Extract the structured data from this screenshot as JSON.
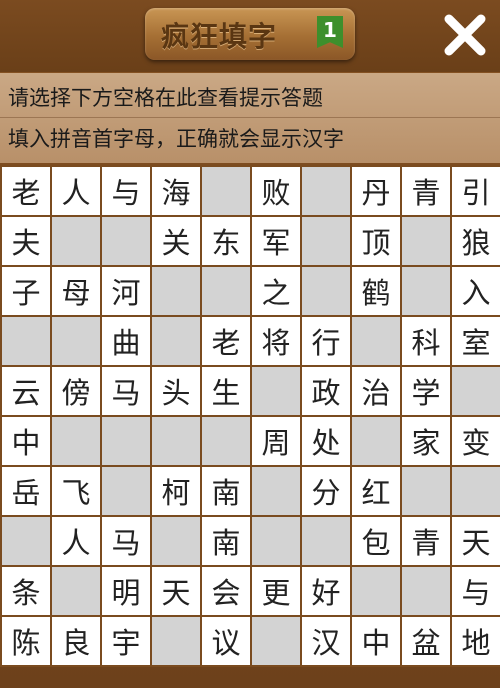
{
  "header": {
    "title": "疯狂填字",
    "level": "1"
  },
  "hints": {
    "line1": "请选择下方空格在此查看提示答题",
    "line2": "填入拼音首字母，正确就会显示汉字"
  },
  "grid": [
    [
      "老",
      "人",
      "与",
      "海",
      "",
      "败",
      "",
      "丹",
      "青",
      "引"
    ],
    [
      "夫",
      "",
      "",
      "关",
      "东",
      "军",
      "",
      "顶",
      "",
      "狼"
    ],
    [
      "子",
      "母",
      "河",
      "",
      "",
      "之",
      "",
      "鹤",
      "",
      "入"
    ],
    [
      "",
      "",
      "曲",
      "",
      "老",
      "将",
      "行",
      "",
      "科",
      "室"
    ],
    [
      "云",
      "傍",
      "马",
      "头",
      "生",
      "",
      "政",
      "治",
      "学",
      ""
    ],
    [
      "中",
      "",
      "",
      "",
      "",
      "周",
      "处",
      "",
      "家",
      "变"
    ],
    [
      "岳",
      "飞",
      "",
      "柯",
      "南",
      "",
      "分",
      "红",
      "",
      ""
    ],
    [
      "",
      "人",
      "马",
      "",
      "南",
      "",
      "",
      "包",
      "青",
      "天"
    ],
    [
      "条",
      "",
      "明",
      "天",
      "会",
      "更",
      "好",
      "",
      "",
      "与"
    ],
    [
      "陈",
      "良",
      "宇",
      "",
      "议",
      "",
      "汉",
      "中",
      "盆",
      "地"
    ]
  ]
}
